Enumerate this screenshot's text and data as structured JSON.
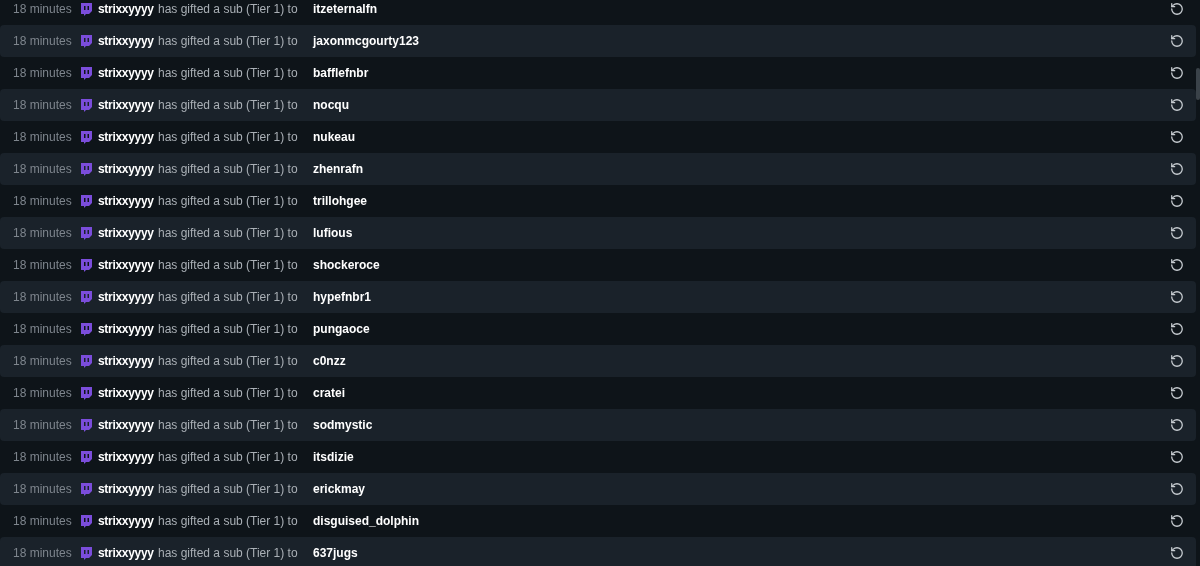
{
  "events": [
    {
      "time": "18 minutes",
      "sender": "strixxyyyy",
      "message": "has gifted a sub (Tier 1) to",
      "recipient": "itzeternalfn"
    },
    {
      "time": "18 minutes",
      "sender": "strixxyyyy",
      "message": "has gifted a sub (Tier 1) to",
      "recipient": "jaxonmcgourty123"
    },
    {
      "time": "18 minutes",
      "sender": "strixxyyyy",
      "message": "has gifted a sub (Tier 1) to",
      "recipient": "bafflefnbr"
    },
    {
      "time": "18 minutes",
      "sender": "strixxyyyy",
      "message": "has gifted a sub (Tier 1) to",
      "recipient": "nocqu"
    },
    {
      "time": "18 minutes",
      "sender": "strixxyyyy",
      "message": "has gifted a sub (Tier 1) to",
      "recipient": "nukeau"
    },
    {
      "time": "18 minutes",
      "sender": "strixxyyyy",
      "message": "has gifted a sub (Tier 1) to",
      "recipient": "zhenrafn"
    },
    {
      "time": "18 minutes",
      "sender": "strixxyyyy",
      "message": "has gifted a sub (Tier 1) to",
      "recipient": "trillohgee"
    },
    {
      "time": "18 minutes",
      "sender": "strixxyyyy",
      "message": "has gifted a sub (Tier 1) to",
      "recipient": "lufious"
    },
    {
      "time": "18 minutes",
      "sender": "strixxyyyy",
      "message": "has gifted a sub (Tier 1) to",
      "recipient": "shockeroce"
    },
    {
      "time": "18 minutes",
      "sender": "strixxyyyy",
      "message": "has gifted a sub (Tier 1) to",
      "recipient": "hypefnbr1"
    },
    {
      "time": "18 minutes",
      "sender": "strixxyyyy",
      "message": "has gifted a sub (Tier 1) to",
      "recipient": "pungaoce"
    },
    {
      "time": "18 minutes",
      "sender": "strixxyyyy",
      "message": "has gifted a sub (Tier 1) to",
      "recipient": "c0nzz"
    },
    {
      "time": "18 minutes",
      "sender": "strixxyyyy",
      "message": "has gifted a sub (Tier 1) to",
      "recipient": "cratei"
    },
    {
      "time": "18 minutes",
      "sender": "strixxyyyy",
      "message": "has gifted a sub (Tier 1) to",
      "recipient": "sodmystic"
    },
    {
      "time": "18 minutes",
      "sender": "strixxyyyy",
      "message": "has gifted a sub (Tier 1) to",
      "recipient": "itsdizie"
    },
    {
      "time": "18 minutes",
      "sender": "strixxyyyy",
      "message": "has gifted a sub (Tier 1) to",
      "recipient": "erickmay"
    },
    {
      "time": "18 minutes",
      "sender": "strixxyyyy",
      "message": "has gifted a sub (Tier 1) to",
      "recipient": "disguised_dolphin"
    },
    {
      "time": "18 minutes",
      "sender": "strixxyyyy",
      "message": "has gifted a sub (Tier 1) to",
      "recipient": "637jugs"
    }
  ]
}
